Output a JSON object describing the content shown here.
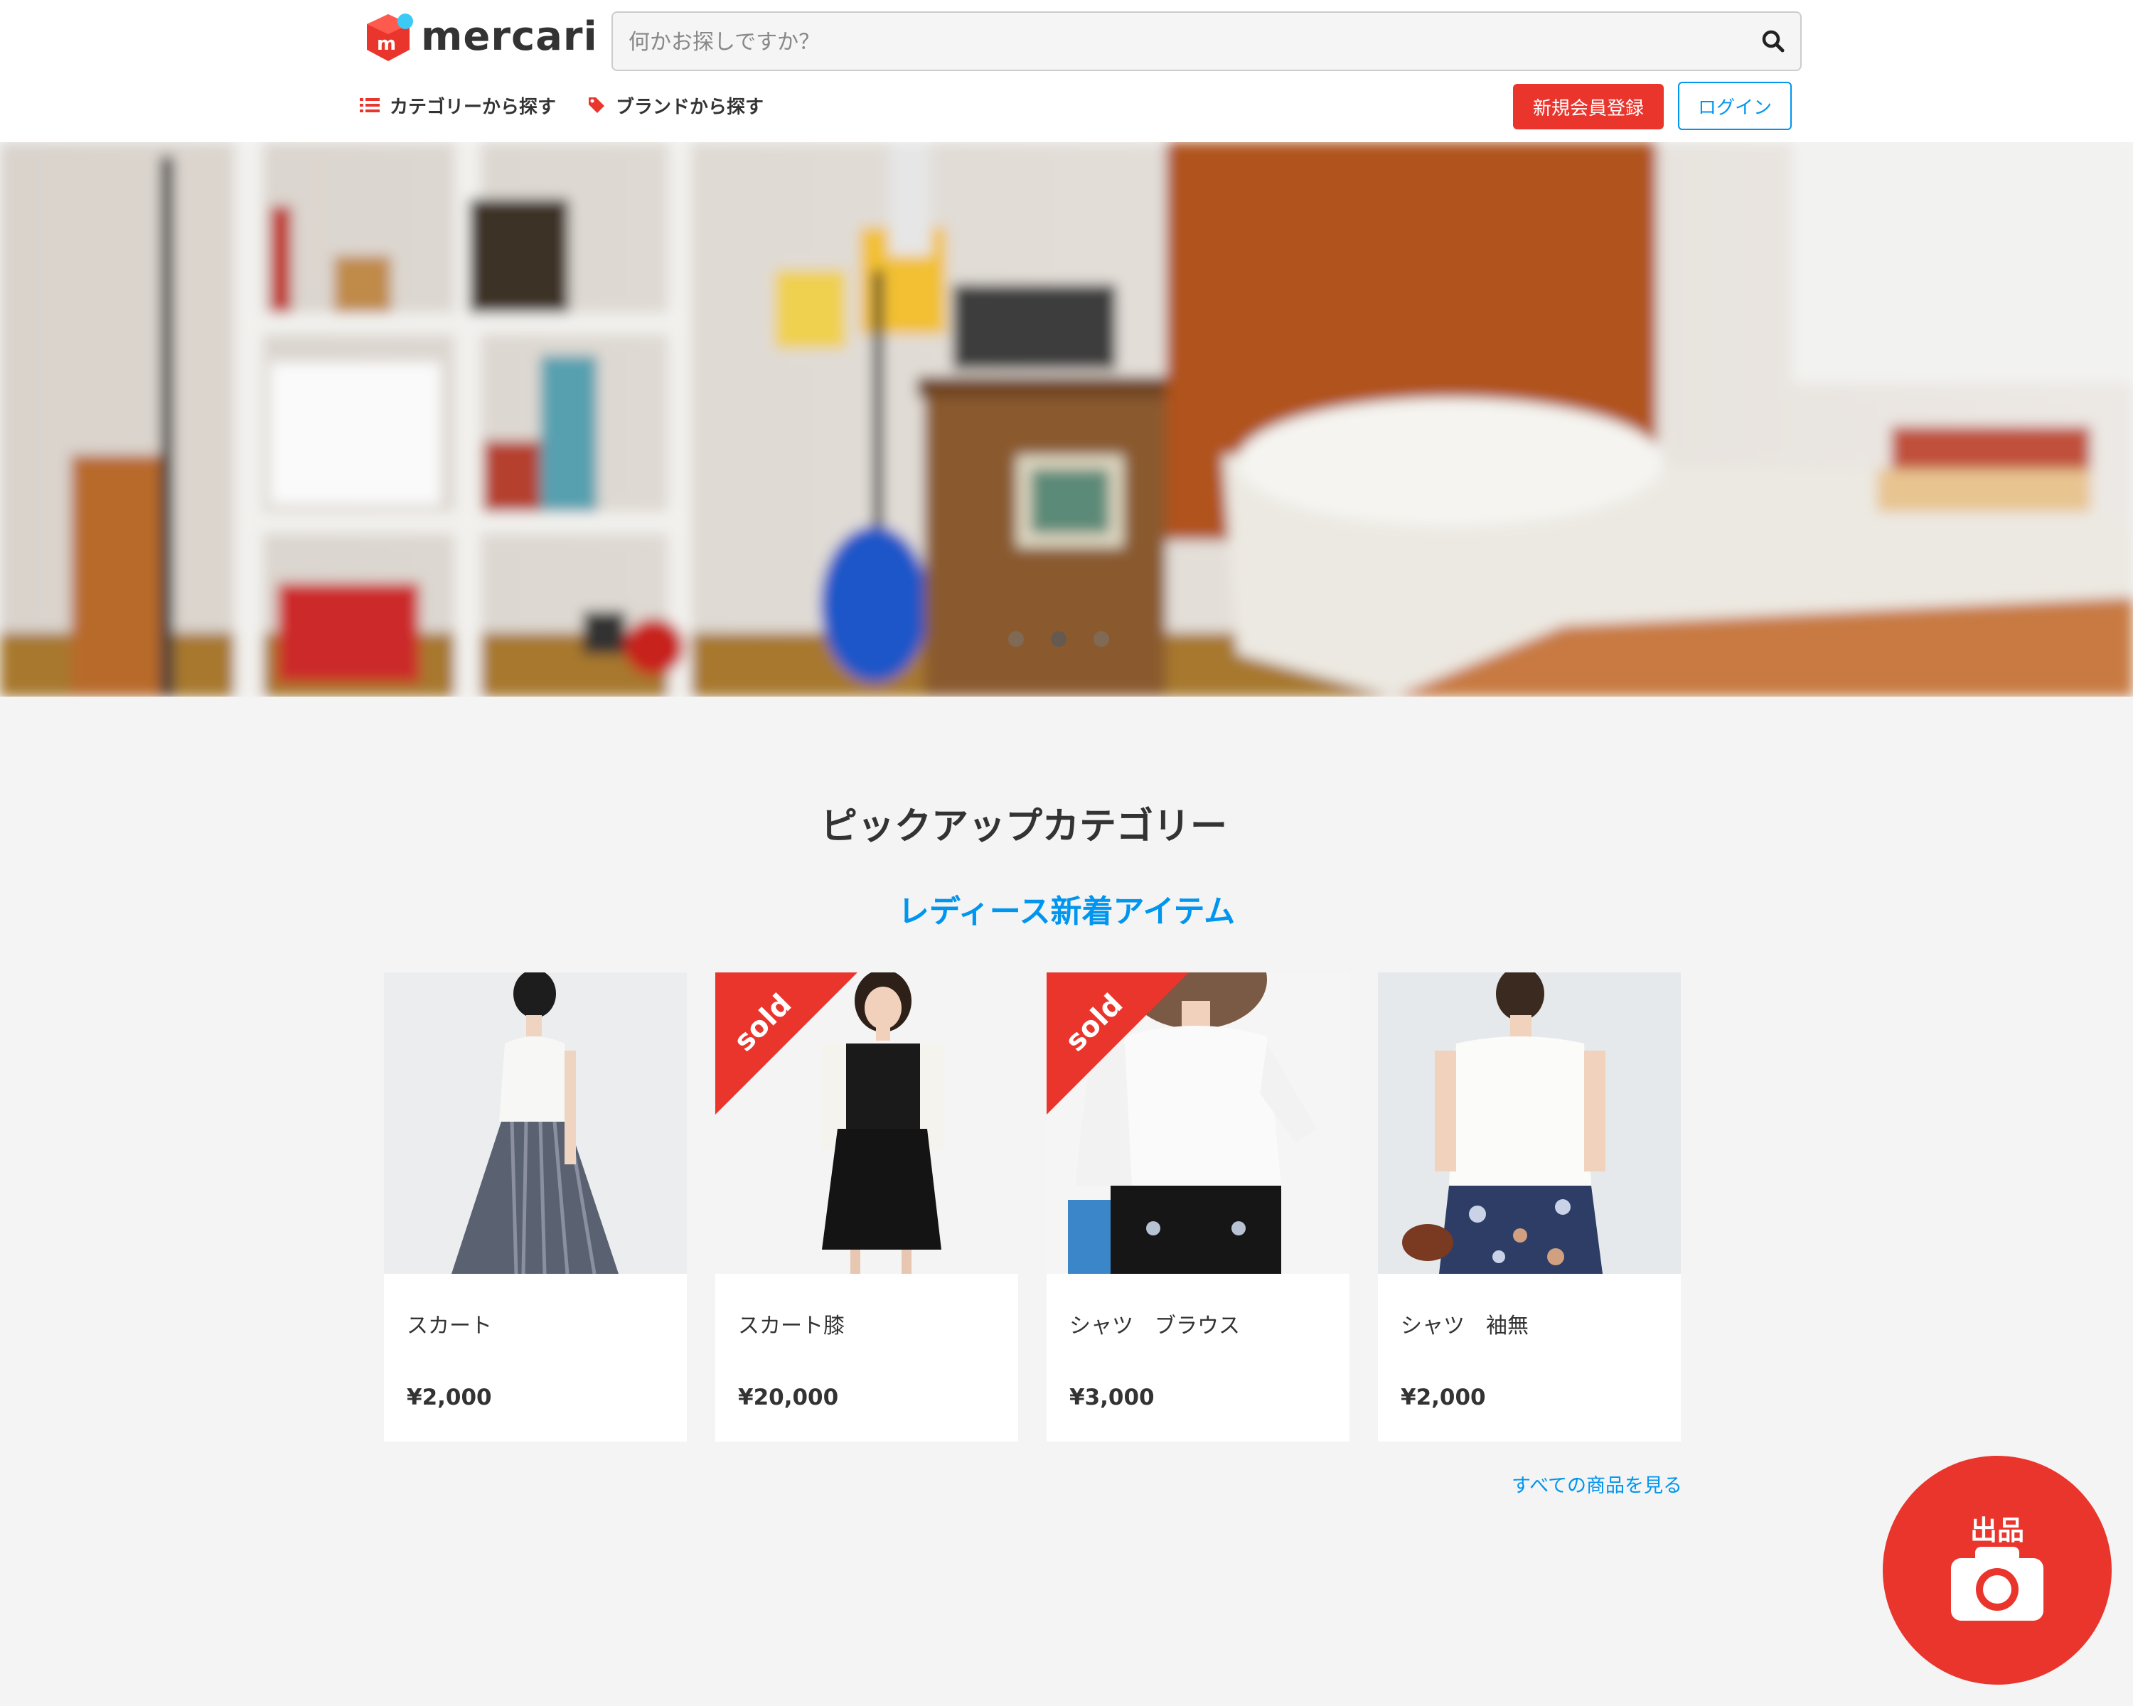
{
  "header": {
    "logo_text": "mercari",
    "search": {
      "placeholder": "何かお探しですか？",
      "value": ""
    },
    "nav": {
      "category_label": "カテゴリーから探す",
      "brand_label": "ブランドから探す"
    },
    "signup_label": "新規会員登録",
    "login_label": "ログイン"
  },
  "hero": {
    "slides": 3,
    "active_slide": 2
  },
  "pickup": {
    "title": "ピックアップカテゴリー",
    "subtitle": "レディース新着アイテム",
    "items": [
      {
        "name": "スカート",
        "price": "¥2,000",
        "sold": false
      },
      {
        "name": "スカート膝",
        "price": "¥20,000",
        "sold": true,
        "sold_label": "sold"
      },
      {
        "name": "シャツ　ブラウス",
        "price": "¥3,000",
        "sold": true,
        "sold_label": "sold"
      },
      {
        "name": "シャツ　袖無",
        "price": "¥2,000",
        "sold": false
      }
    ],
    "see_all_label": "すべての商品を見る"
  },
  "fab": {
    "label": "出品",
    "icon": "camera-icon"
  },
  "colors": {
    "brand_red": "#ea352d",
    "link_blue": "#0095ee"
  }
}
